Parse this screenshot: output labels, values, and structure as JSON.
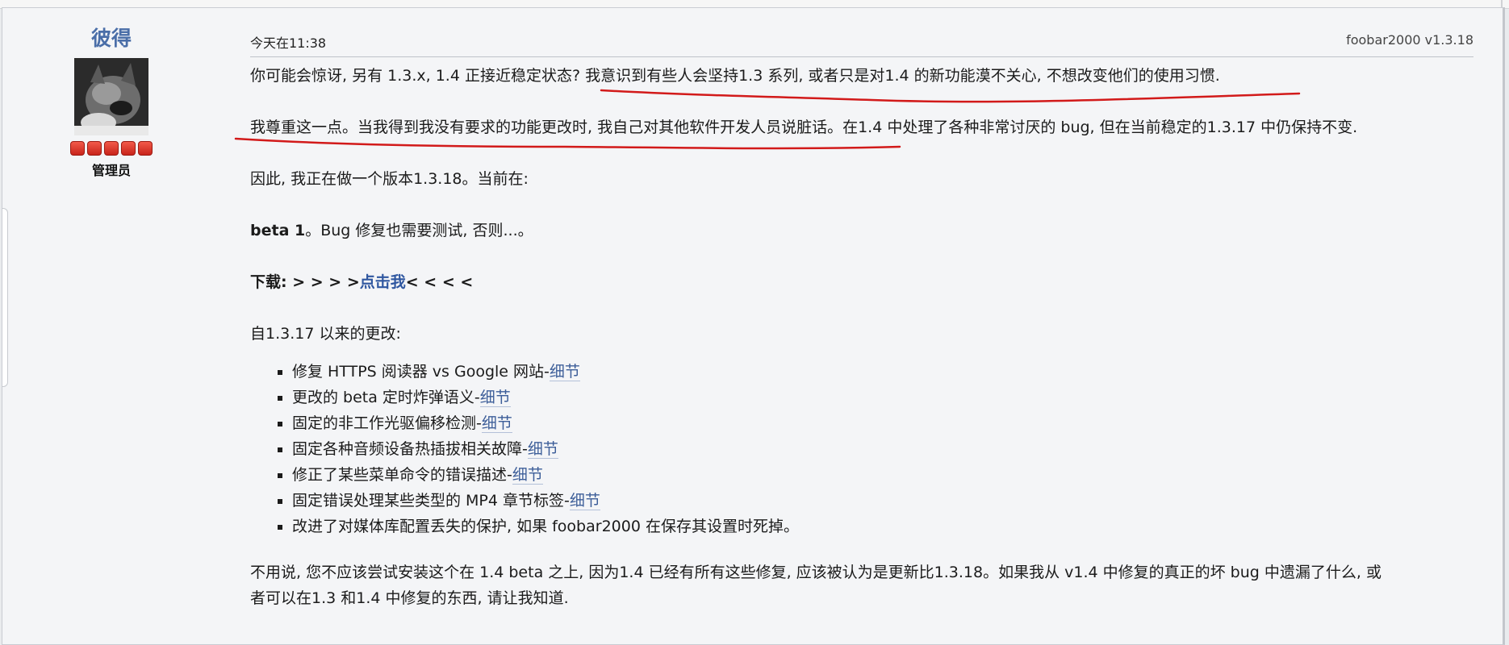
{
  "author": {
    "name": "彼得",
    "role": "管理员",
    "rank_count": 5
  },
  "post": {
    "time": "今天在11:38",
    "tag": "foobar2000 v1.3.18",
    "p1": "你可能会惊讶, 另有 1.3.x, 1.4 正接近稳定状态?  我意识到有些人会坚持1.3 系列, 或者只是对1.4 的新功能漠不关心, 不想改变他们的使用习惯.",
    "p2": "我尊重这一点。当我得到我没有要求的功能更改时, 我自己对其他软件开发人员说脏话。在1.4 中处理了各种非常讨厌的 bug, 但在当前稳定的1.3.17 中仍保持不变.",
    "p3": "因此, 我正在做一个版本1.3.18。当前在:",
    "p4_bold": "beta 1",
    "p4_rest": "。Bug 修复也需要测试, 否则...。",
    "download_label": "下载: > > > >",
    "download_link": "点击我",
    "download_after": "< < < <",
    "changes_header": "自1.3.17 以来的更改:",
    "changes": [
      {
        "text": "修复 HTTPS 阅读器 vs Google 网站-",
        "link": "细节"
      },
      {
        "text": "更改的 beta 定时炸弹语义-",
        "link": "细节"
      },
      {
        "text": "固定的非工作光驱偏移检测-",
        "link": "细节"
      },
      {
        "text": "固定各种音频设备热插拔相关故障-",
        "link": "细节"
      },
      {
        "text": "修正了某些菜单命令的错误描述-",
        "link": "细节"
      },
      {
        "text": "固定错误处理某些类型的 MP4 章节标签-",
        "link": "细节"
      },
      {
        "text": "改进了对媒体库配置丢失的保护, 如果 foobar2000 在保存其设置时死掉。",
        "link": ""
      }
    ],
    "p_final_1": "不用说, 您不应该尝试安装这个在 1.4 beta 之上, 因为1.4 已经有所有这些修复, 应该被认为是更新比1.3.18。如果我从 v1.4 中修复的真正的坏 bug 中遗漏了什么, 或",
    "p_final_2": "者可以在1.3 和1.4 中修复的东西, 请让我知道."
  },
  "colors": {
    "author_link": "#4a6ea8",
    "link": "#3d5e99",
    "annotation": "#d21a1a",
    "rank": "#e23a2c"
  }
}
